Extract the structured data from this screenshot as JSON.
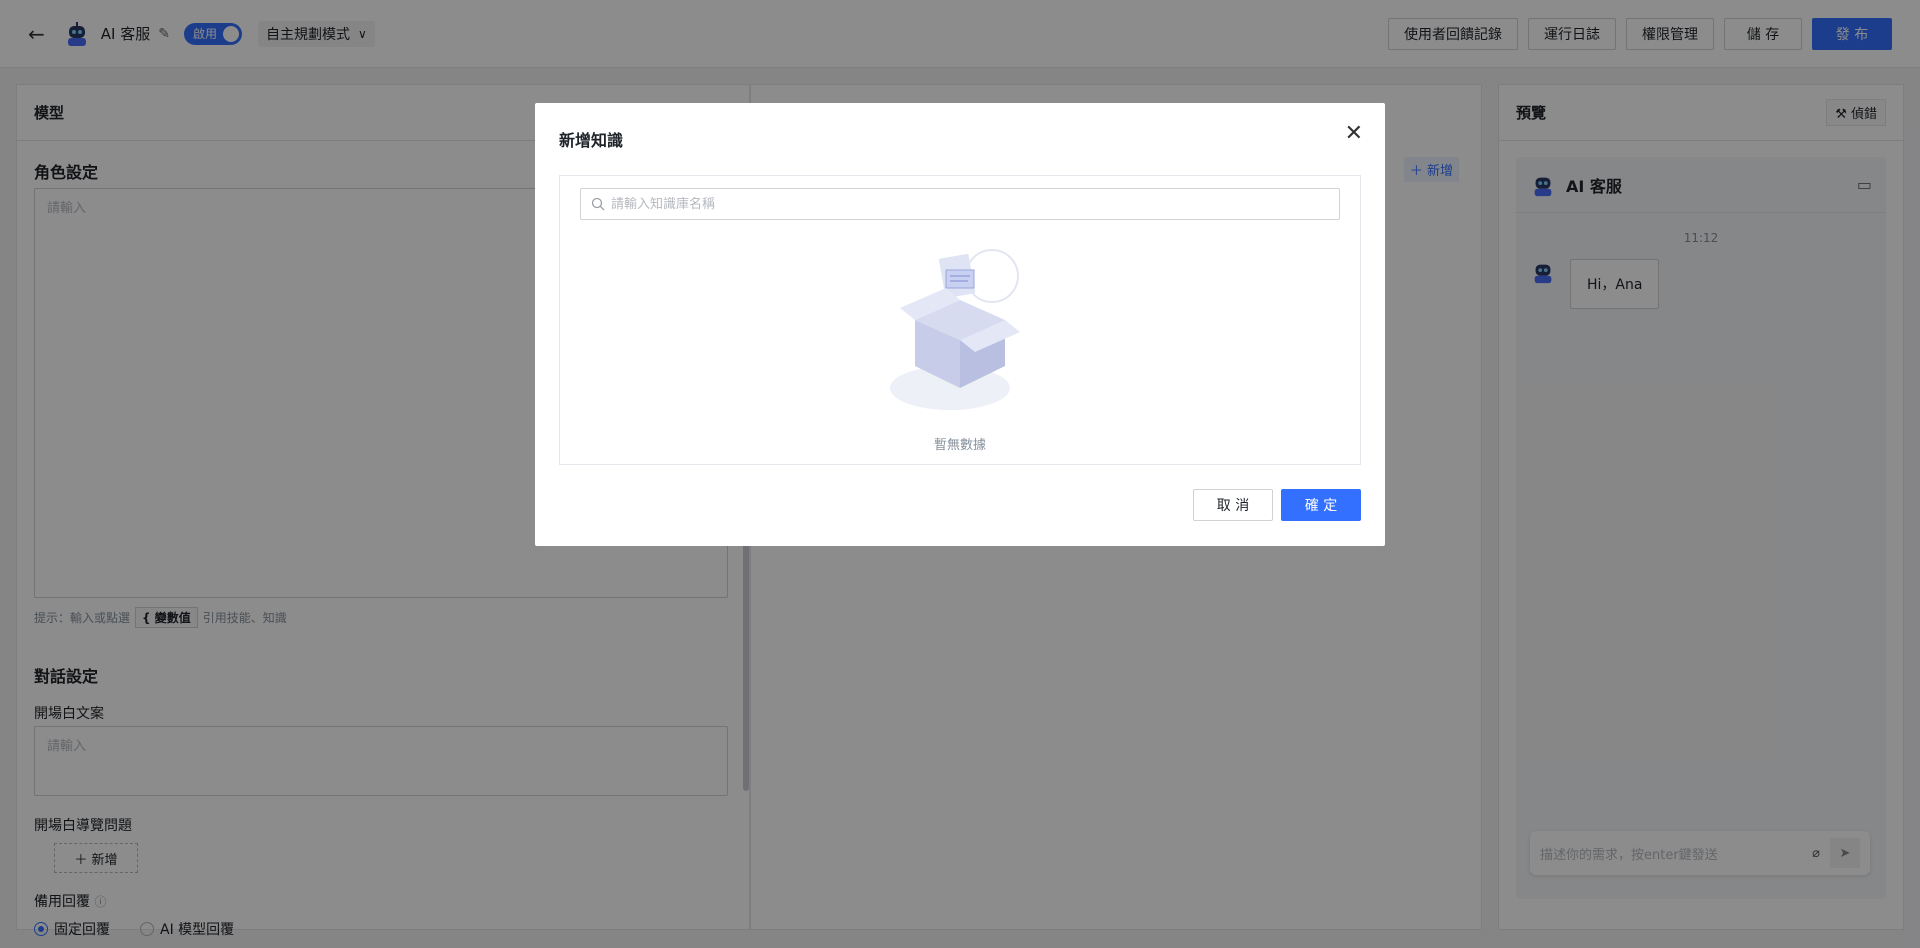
{
  "topbar": {
    "back_icon": "arrow-left-icon",
    "app_name": "AI 客服",
    "toggle_label": "啟用",
    "mode": "自主規劃模式",
    "actions": {
      "feedback": "使用者回饋記錄",
      "logs": "運行日誌",
      "permissions": "權限管理",
      "save": "儲 存",
      "publish": "發 布"
    }
  },
  "left_panel": {
    "header": "模型",
    "role_title": "角色設定",
    "role_placeholder": "請輸入",
    "hint_prefix": "提示：輸入或點選",
    "hint_var": "{ 變數值",
    "hint_suffix": "引用技能、知識",
    "dialog_title": "對話設定",
    "opening_label": "開場白文案",
    "opening_placeholder": "請輸入",
    "guide_label": "開場白導覽問題",
    "add_label": "＋ 新增",
    "fallback_label": "備用回覆",
    "radio_fixed": "固定回覆",
    "radio_ai": "AI 模型回覆"
  },
  "middle_panel": {
    "add_label": "＋ 新增"
  },
  "preview": {
    "header": "預覽",
    "debug_label": "偵錯",
    "bot_name": "AI 客服",
    "time": "11:12",
    "greeting": "Hi，Ana",
    "input_placeholder": "描述你的需求，按enter鍵發送"
  },
  "modal": {
    "title": "新增知識",
    "search_placeholder": "請輸入知識庫名稱",
    "empty_text": "暫無數據",
    "cancel": "取 消",
    "confirm": "確 定"
  },
  "colors": {
    "primary": "#3370ff",
    "overlay": "rgba(0,0,0,0.45)"
  }
}
